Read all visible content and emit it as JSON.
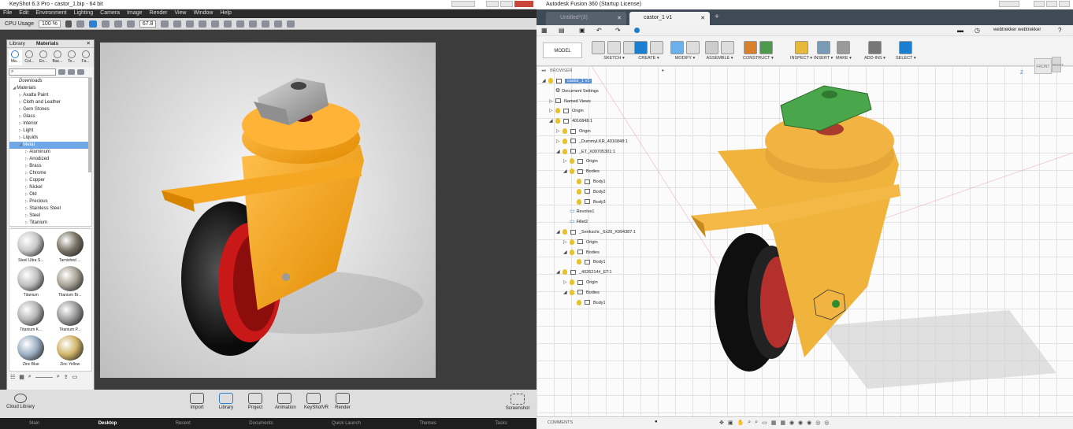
{
  "keyshot": {
    "title": "KeyShot 6.3 Pro  - castor_1.bip  - 64 bit",
    "menu": [
      "File",
      "Edit",
      "Environment",
      "Lighting",
      "Camera",
      "Image",
      "Render",
      "View",
      "Window",
      "Help"
    ],
    "toolbar": {
      "cpu_label": "CPU Usage",
      "cpu_value": "100 %",
      "zoom_value": "67.8"
    },
    "library": {
      "title_tabs": [
        "Library",
        "Materials"
      ],
      "categories": [
        "Ma...",
        "Col...",
        "En...",
        "Bac...",
        "Te...",
        "Fa..."
      ],
      "tree": [
        {
          "label": "Downloads",
          "indent": 1
        },
        {
          "label": "Materials",
          "indent": 0
        },
        {
          "label": "Axalta Paint",
          "indent": 1
        },
        {
          "label": "Cloth and Leather",
          "indent": 1
        },
        {
          "label": "Gem Stones",
          "indent": 1
        },
        {
          "label": "Glass",
          "indent": 1
        },
        {
          "label": "Interior",
          "indent": 1
        },
        {
          "label": "Light",
          "indent": 1
        },
        {
          "label": "Liquids",
          "indent": 1
        },
        {
          "label": "Metal",
          "indent": 1,
          "selected": true
        },
        {
          "label": "Aluminum",
          "indent": 2
        },
        {
          "label": "Anodized",
          "indent": 2
        },
        {
          "label": "Brass",
          "indent": 2
        },
        {
          "label": "Chrome",
          "indent": 2
        },
        {
          "label": "Copper",
          "indent": 2
        },
        {
          "label": "Nickel",
          "indent": 2
        },
        {
          "label": "Old",
          "indent": 2
        },
        {
          "label": "Precious",
          "indent": 2
        },
        {
          "label": "Stainless Steel",
          "indent": 2
        },
        {
          "label": "Steel",
          "indent": 2
        },
        {
          "label": "Titanium",
          "indent": 2
        }
      ],
      "thumbnails": [
        "Steel Ultra S...",
        "Tarnished ...",
        "Titanium",
        "Titanium Br...",
        "Titanium K...",
        "Titanium P...",
        "Zinc Blue",
        "Zinc Yellow"
      ]
    },
    "bottom_buttons": [
      "Import",
      "Library",
      "Project",
      "Animation",
      "KeyShotVR",
      "Render"
    ],
    "cloud_library": "Cloud Library",
    "screenshot": "Screenshot",
    "taskbar": [
      "Main",
      "Desktop",
      "Recent",
      "Documents",
      "Quick Launch",
      "Themes",
      "Tasks"
    ]
  },
  "fusion": {
    "title": "Autodesk Fusion 360 (Startup License)",
    "tabs": [
      "Untitled*(3)",
      "castor_1 v1"
    ],
    "user": "webtrekker webtrekker",
    "workspace": "MODEL",
    "ribbon": [
      "SKETCH",
      "CREATE",
      "MODIFY",
      "ASSEMBLE",
      "CONSTRUCT",
      "INSPECT",
      "INSERT",
      "MAKE",
      "ADD-INS",
      "SELECT"
    ],
    "browser_label": "BROWSER",
    "comments": "COMMENTS",
    "viewcube": [
      "FRONT",
      "RIGHT"
    ],
    "axis": "Z",
    "tree": [
      {
        "label": "castor_1 v1",
        "level": 0,
        "type": "root"
      },
      {
        "label": "Document Settings",
        "level": 1,
        "type": "gear"
      },
      {
        "label": "Named Views",
        "level": 1,
        "type": "folder"
      },
      {
        "label": "Origin",
        "level": 1,
        "type": "folder"
      },
      {
        "label": "4016848:1",
        "level": 1,
        "type": "comp"
      },
      {
        "label": "Origin",
        "level": 2,
        "type": "folder"
      },
      {
        "label": "_DummyLKR_4016848:1",
        "level": 2,
        "type": "comp"
      },
      {
        "label": "_ET_X09705301:1",
        "level": 2,
        "type": "comp"
      },
      {
        "label": "Origin",
        "level": 3,
        "type": "folder"
      },
      {
        "label": "Bodies",
        "level": 3,
        "type": "folder"
      },
      {
        "label": "Body1",
        "level": 4,
        "type": "body"
      },
      {
        "label": "Body2",
        "level": 4,
        "type": "body"
      },
      {
        "label": "Body3",
        "level": 4,
        "type": "body"
      },
      {
        "label": "Revolve1",
        "level": 3,
        "type": "feature"
      },
      {
        "label": "Fillet2",
        "level": 3,
        "type": "feature"
      },
      {
        "label": "_Senkschr._6x20_X094387:1",
        "level": 2,
        "type": "comp"
      },
      {
        "label": "Origin",
        "level": 3,
        "type": "folder"
      },
      {
        "label": "Bodies",
        "level": 3,
        "type": "folder"
      },
      {
        "label": "Body1",
        "level": 4,
        "type": "body"
      },
      {
        "label": "_4026214#_ET:1",
        "level": 2,
        "type": "comp"
      },
      {
        "label": "Origin",
        "level": 3,
        "type": "folder"
      },
      {
        "label": "Bodies",
        "level": 3,
        "type": "folder"
      },
      {
        "label": "Body1",
        "level": 4,
        "type": "body"
      }
    ]
  }
}
